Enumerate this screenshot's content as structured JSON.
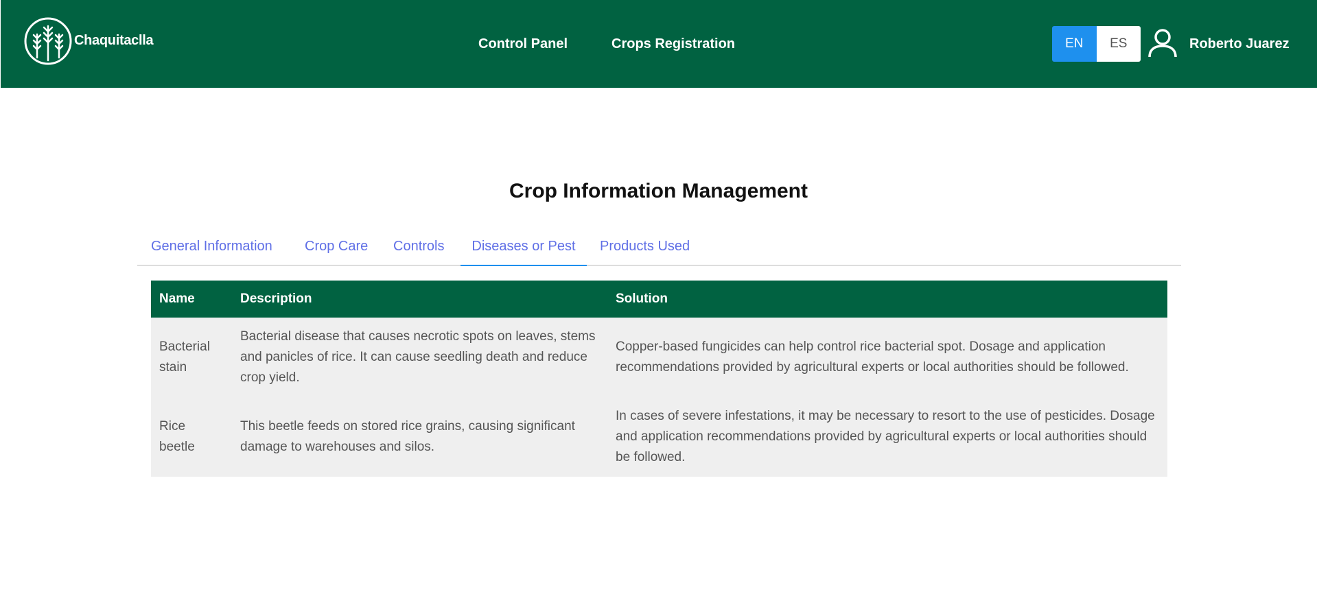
{
  "header": {
    "brand": "Chaquitaclla",
    "nav": {
      "control_panel": "Control Panel",
      "crops_registration": "Crops Registration"
    },
    "language": {
      "en": "EN",
      "es": "ES",
      "selected": "EN"
    },
    "user": {
      "name": "Roberto Juarez"
    }
  },
  "main": {
    "title": "Crop Information Management",
    "tabs": [
      {
        "label": "General Information"
      },
      {
        "label": "Crop Care"
      },
      {
        "label": "Controls"
      },
      {
        "label": "Diseases or Pest"
      },
      {
        "label": "Products Used"
      }
    ],
    "active_tab": "Diseases or Pest",
    "table": {
      "columns": [
        "Name",
        "Description",
        "Solution"
      ],
      "rows": [
        {
          "name": "Bacterial stain",
          "description": "Bacterial disease that causes necrotic spots on leaves, stems and panicles of rice. It can cause seedling death and reduce crop yield.",
          "solution": "Copper-based fungicides can help control rice bacterial spot. Dosage and application recommendations provided by agricultural experts or local authorities should be followed."
        },
        {
          "name": "Rice beetle",
          "description": "This beetle feeds on stored rice grains, causing significant damage to warehouses and silos.",
          "solution": "In cases of severe infestations, it may be necessary to resort to the use of pesticides. Dosage and application recommendations provided by agricultural experts or local authorities should be followed."
        }
      ]
    }
  },
  "colors": {
    "header_bg": "#016241",
    "accent_blue": "#1e90ee",
    "tab_text": "#5f6fe6",
    "row_bg": "#efefef"
  },
  "icons": {
    "logo": "wheat-logo-icon",
    "user": "user-icon"
  }
}
